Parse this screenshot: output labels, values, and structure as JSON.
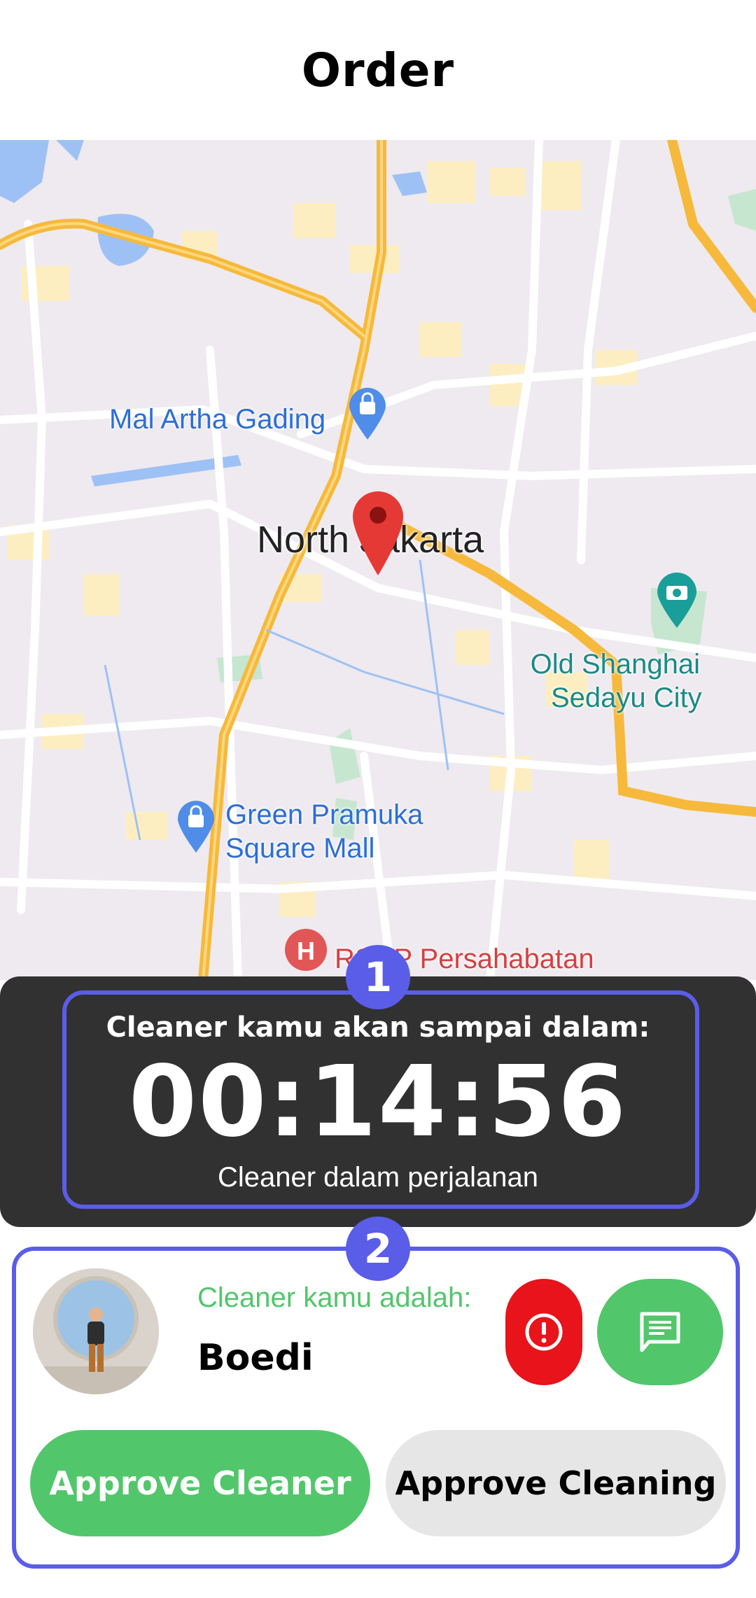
{
  "header": {
    "title": "Order"
  },
  "map": {
    "labels": {
      "mal_artha_gading": "Mal Artha Gading",
      "north_jakarta": "North Jakarta",
      "old_shanghai_line1": "Old Shanghai",
      "old_shanghai_line2": "Sedayu City",
      "green_pramuka_line1": "Green Pramuka",
      "green_pramuka_line2": "Square Mall",
      "rs_persahabatan": "RSUP Persahabatan"
    },
    "icons": [
      "shopping-bag-pin-icon",
      "location-pin-icon",
      "camera-pin-icon",
      "hospital-pin-icon"
    ]
  },
  "eta": {
    "badge": "1",
    "label": "Cleaner kamu akan sampai dalam:",
    "time": "00:14:56",
    "status": "Cleaner dalam perjalanan"
  },
  "cleaner": {
    "badge": "2",
    "label": "Cleaner kamu adalah:",
    "name": "Boedi",
    "alert_icon": "alert-icon",
    "chat_icon": "chat-icon",
    "approve_cleaner": "Approve Cleaner",
    "approve_cleaning": "Approve Cleaning"
  },
  "colors": {
    "accent": "#5a5de8",
    "green": "#52c66b",
    "red": "#e8131b",
    "dark_panel": "#313131",
    "road": "#f6b93b"
  }
}
